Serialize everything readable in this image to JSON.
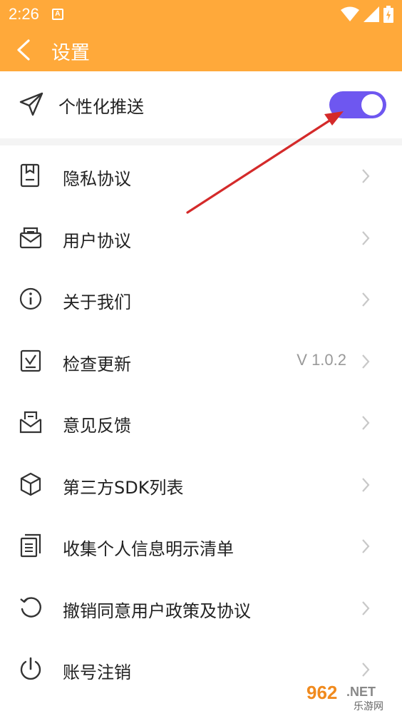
{
  "status_bar": {
    "time": "2:26",
    "notification_glyph": "A"
  },
  "app_bar": {
    "title": "设置"
  },
  "personalized_push": {
    "label": "个性化推送",
    "enabled": true,
    "accent": "#6E57F0"
  },
  "menu": {
    "items": [
      {
        "id": "privacy",
        "label": "隐私协议",
        "icon": "document-icon",
        "value": ""
      },
      {
        "id": "user-agreement",
        "label": "用户协议",
        "icon": "inbox-icon",
        "value": ""
      },
      {
        "id": "about",
        "label": "关于我们",
        "icon": "info-icon",
        "value": ""
      },
      {
        "id": "update",
        "label": "检查更新",
        "icon": "check-box-icon",
        "value": "V 1.0.2"
      },
      {
        "id": "feedback",
        "label": "意见反馈",
        "icon": "mail-feedback-icon",
        "value": ""
      },
      {
        "id": "sdk-list",
        "label": "第三方SDK列表",
        "icon": "cube-icon",
        "value": ""
      },
      {
        "id": "info-list",
        "label": "收集个人信息明示清单",
        "icon": "list-doc-icon",
        "value": ""
      },
      {
        "id": "revoke",
        "label": "撤销同意用户政策及协议",
        "icon": "undo-icon",
        "value": ""
      },
      {
        "id": "cancel-account",
        "label": "账号注销",
        "icon": "power-icon",
        "value": ""
      }
    ]
  },
  "watermark": {
    "brand": "962",
    "suffix": ".NET",
    "subtitle": "乐游网"
  },
  "colors": {
    "header": "#FFA93A",
    "toggle": "#6E57F0",
    "annotation_arrow": "#D42A2A"
  }
}
